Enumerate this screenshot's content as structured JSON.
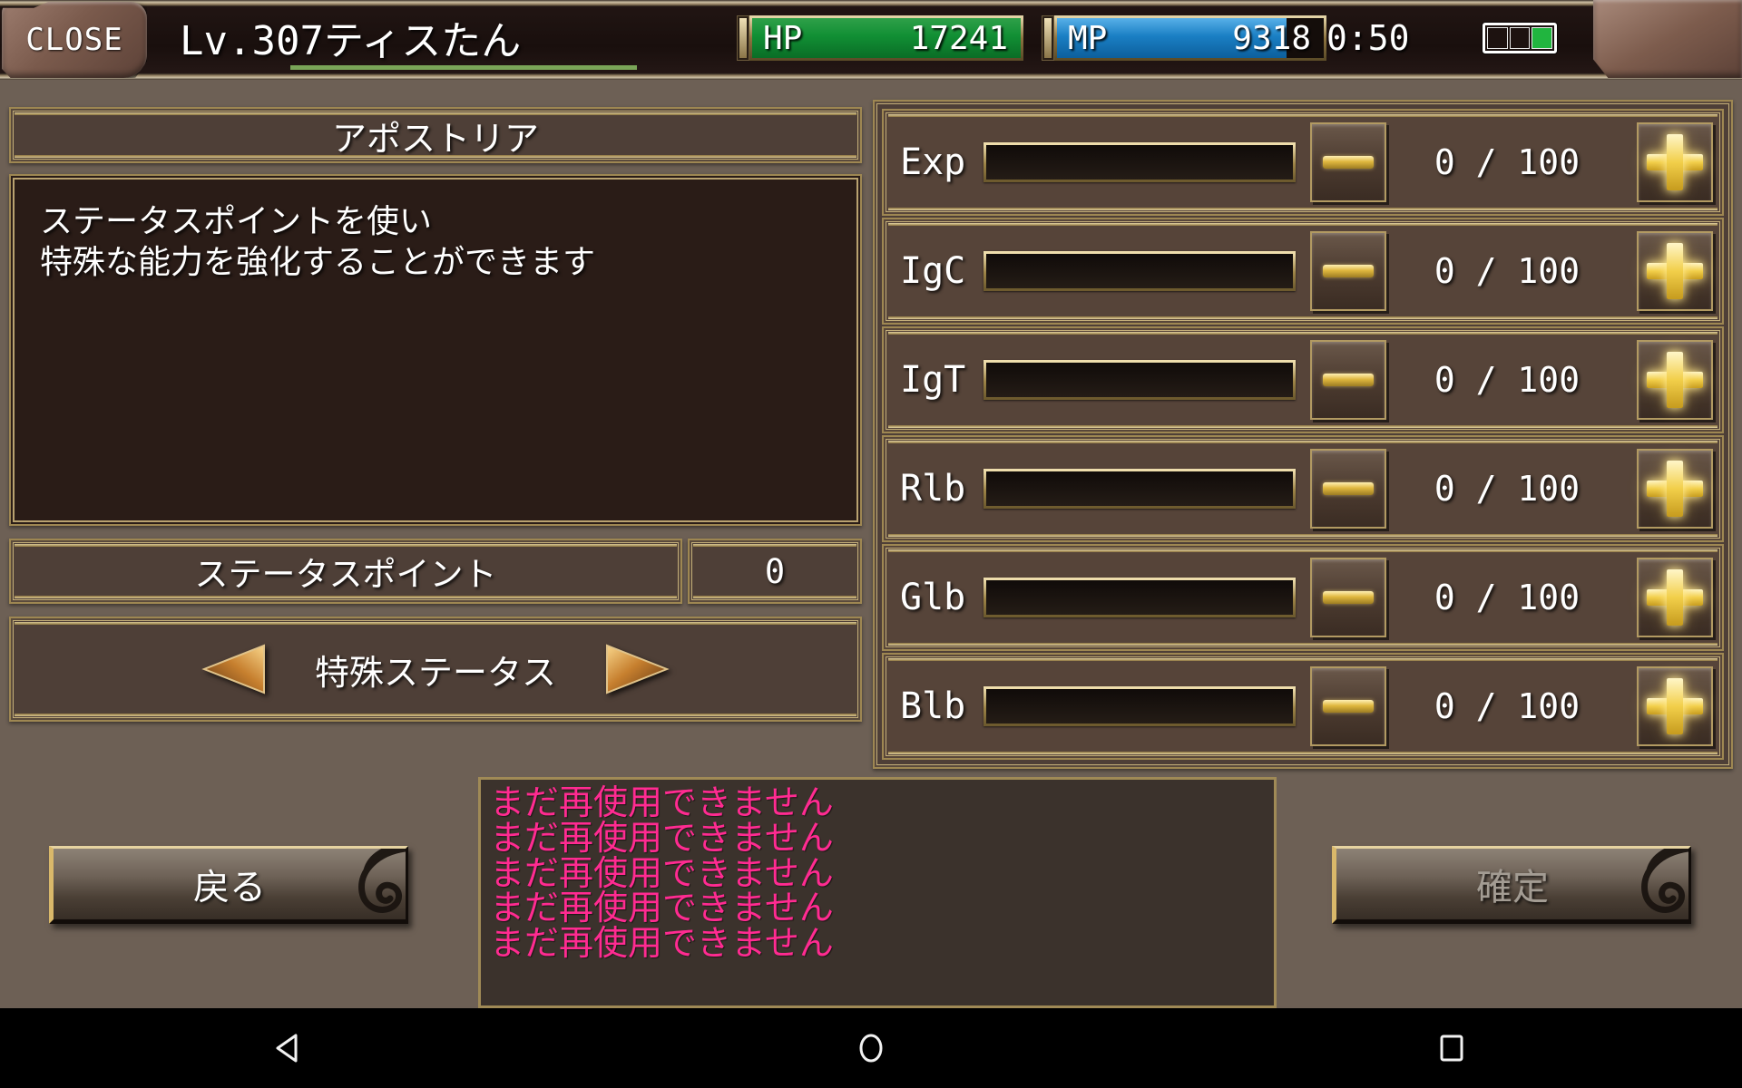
{
  "header": {
    "close_label": "CLOSE",
    "player_name": "Lv.307ティスたん",
    "hp": {
      "label": "HP",
      "value": "17241"
    },
    "mp": {
      "label": "MP",
      "value": "9318"
    },
    "clock": "0:50",
    "battery_icon": "battery-icon",
    "hp_fill_pct": 100,
    "mp_fill_pct": 86,
    "hp_color": "#118f34",
    "mp_color": "#1a7fc4",
    "exp_underline_color": "#7aa558"
  },
  "left": {
    "title": "アポストリア",
    "description": "ステータスポイントを使い\n特殊な能力を強化することができます",
    "description_line1": "ステータスポイントを使い",
    "description_line2": "特殊な能力を強化することができます",
    "status_point_label": "ステータスポイント",
    "status_point_value": "0",
    "special_status_label": "特殊ステータス",
    "prev_icon": "arrow-left-icon",
    "next_icon": "arrow-right-icon"
  },
  "stats": [
    {
      "label": "Exp",
      "value": "0",
      "max": "100",
      "display": "0 / 100",
      "fill_pct": 0
    },
    {
      "label": "IgC",
      "value": "0",
      "max": "100",
      "display": "0 / 100",
      "fill_pct": 0
    },
    {
      "label": "IgT",
      "value": "0",
      "max": "100",
      "display": "0 / 100",
      "fill_pct": 0
    },
    {
      "label": "Rlb",
      "value": "0",
      "max": "100",
      "display": "0 / 100",
      "fill_pct": 0
    },
    {
      "label": "Glb",
      "value": "0",
      "max": "100",
      "display": "0 / 100",
      "fill_pct": 0
    },
    {
      "label": "Blb",
      "value": "0",
      "max": "100",
      "display": "0 / 100",
      "fill_pct": 0
    }
  ],
  "log": {
    "text_color": "#ff2b91",
    "lines": [
      "まだ再使用できません",
      "まだ再使用できません",
      "まだ再使用できません",
      "まだ再使用できません",
      "まだ再使用できません"
    ]
  },
  "footer": {
    "back_label": "戻る",
    "confirm_label": "確定",
    "confirm_disabled": true
  },
  "android_nav": {
    "back_icon": "triangle-back-icon",
    "home_icon": "circle-home-icon",
    "recents_icon": "square-recents-icon"
  }
}
